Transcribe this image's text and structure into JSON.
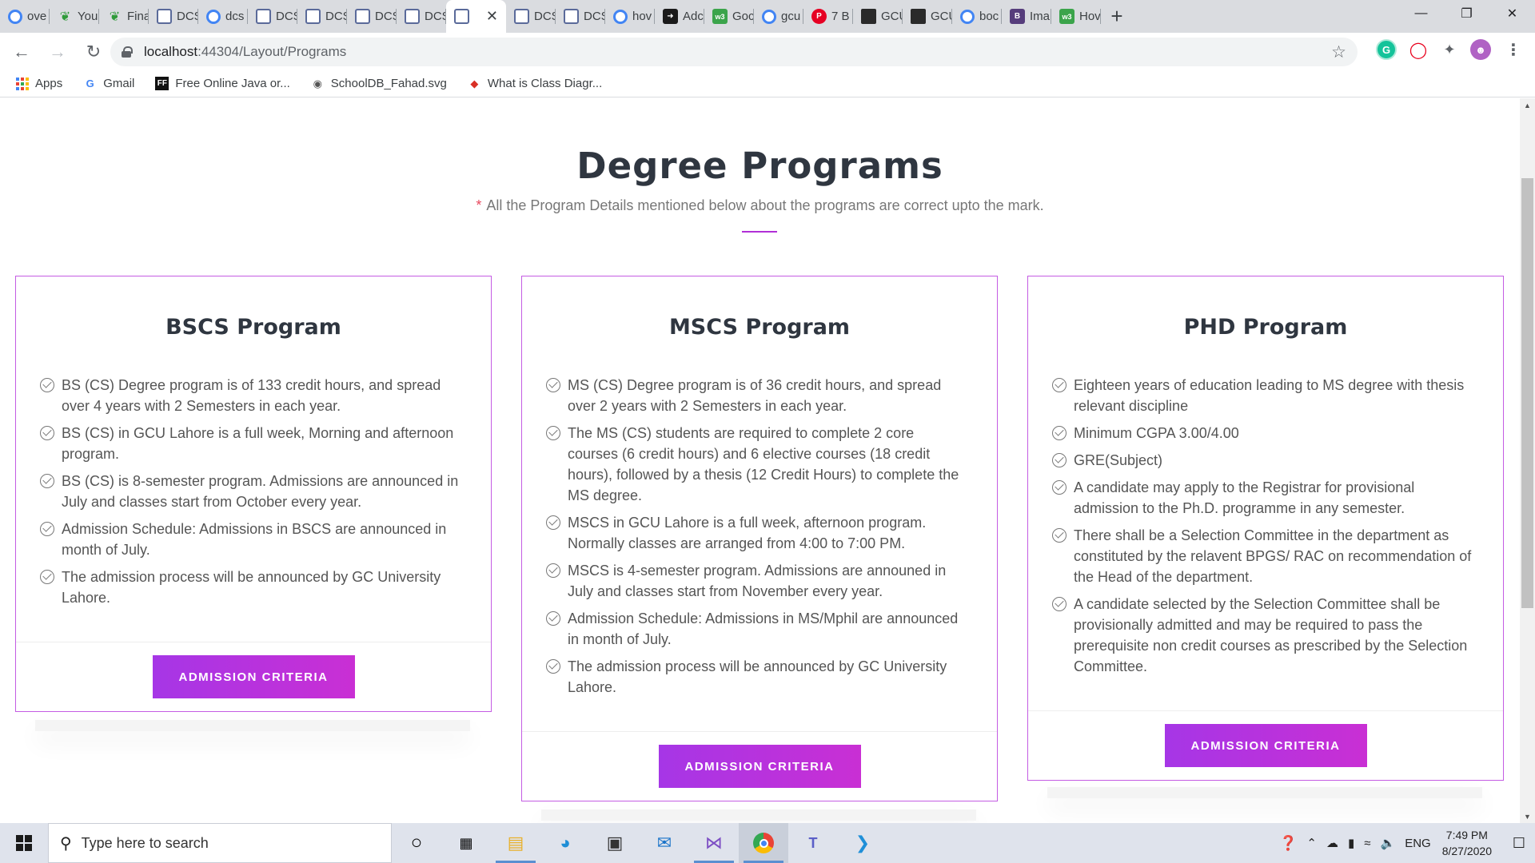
{
  "browser": {
    "tabs": [
      {
        "label": "ove",
        "icon": "google-icon"
      },
      {
        "label": "You",
        "icon": "leaf-icon"
      },
      {
        "label": "Fina",
        "icon": "leaf-icon"
      },
      {
        "label": "DCS",
        "icon": "shield-icon"
      },
      {
        "label": "dcs",
        "icon": "google-icon"
      },
      {
        "label": "DCS",
        "icon": "shield-icon"
      },
      {
        "label": "DCS",
        "icon": "shield-icon"
      },
      {
        "label": "DCS",
        "icon": "shield-icon"
      },
      {
        "label": "DCS",
        "icon": "shield-icon"
      },
      {
        "label": "",
        "icon": "shield-icon",
        "active": true
      },
      {
        "label": "DCS",
        "icon": "shield-icon"
      },
      {
        "label": "DCS",
        "icon": "shield-icon"
      },
      {
        "label": "hov",
        "icon": "google-icon"
      },
      {
        "label": "Adc",
        "icon": "arrow-icon"
      },
      {
        "label": "Goc",
        "icon": "w3-icon"
      },
      {
        "label": "gcu",
        "icon": "google-icon"
      },
      {
        "label": "7 B",
        "icon": "pinterest-icon"
      },
      {
        "label": "GCU",
        "icon": "crest-icon"
      },
      {
        "label": "GCU",
        "icon": "crest-icon"
      },
      {
        "label": "boc",
        "icon": "google-icon"
      },
      {
        "label": "Ima",
        "icon": "bootstrap-icon"
      },
      {
        "label": "Hov",
        "icon": "w3-icon"
      }
    ],
    "new_tab": "+",
    "url_host": "localhost",
    "url_path": ":44304/Layout/Programs",
    "bookmarks": [
      {
        "label": "Apps",
        "icon": "apps-icon"
      },
      {
        "label": "Gmail",
        "icon": "google-icon"
      },
      {
        "label": "Free Online Java or...",
        "icon": "ff-icon"
      },
      {
        "label": "SchoolDB_Fahad.svg",
        "icon": "globe-icon"
      },
      {
        "label": "What is Class Diagr...",
        "icon": "diamond-icon"
      }
    ]
  },
  "page": {
    "title": "Degree Programs",
    "subtitle_marker": "*",
    "subtitle": "All the Program Details mentioned below about the programs are correct upto the mark.",
    "accent_color": "#b12fd6",
    "programs": [
      {
        "title": "BSCS Program",
        "items": [
          "BS (CS) Degree program is of 133 credit hours, and spread over 4 years with 2 Semesters in each year.",
          "BS (CS) in GCU Lahore is a full week, Morning and afternoon program.",
          "BS (CS) is 8-semester program. Admissions are announced in July and classes start from October every year.",
          "Admission Schedule: Admissions in BSCS are announced in month of July.",
          "The admission process will be announced by GC University Lahore."
        ],
        "button": "ADMISSION CRITERIA"
      },
      {
        "title": "MSCS Program",
        "items": [
          "MS (CS) Degree program is of 36 credit hours, and spread over 2 years with 2 Semesters in each year.",
          "The MS (CS) students are required to complete 2 core courses (6 credit hours) and 6 elective courses (18 credit hours), followed by a thesis (12 Credit Hours) to complete the MS degree.",
          "MSCS in GCU Lahore is a full week, afternoon program. Normally classes are arranged from 4:00 to 7:00 PM.",
          "MSCS is 4-semester program. Admissions are announed in July and classes start from November every year.",
          "Admission Schedule: Admissions in MS/Mphil are announced in month of July.",
          "The admission process will be announced by GC University Lahore."
        ],
        "button": "ADMISSION CRITERIA"
      },
      {
        "title": "PHD Program",
        "items": [
          "Eighteen years of education leading to MS degree with thesis relevant discipline",
          "Minimum CGPA 3.00/4.00",
          "GRE(Subject)",
          "A candidate may apply to the Registrar for provisional admission to the Ph.D. programme in any semester.",
          "There shall be a Selection Committee in the department as constituted by the relavent BPGS/ RAC on recommendation of the Head of the department.",
          "A candidate selected by the Selection Committee shall be provisionally admitted and may be required to pass the prerequisite non credit courses as prescribed by the Selection Committee."
        ],
        "button": "ADMISSION CRITERIA"
      }
    ]
  },
  "taskbar": {
    "search_placeholder": "Type here to search",
    "language": "ENG",
    "time": "7:49 PM",
    "date": "8/27/2020"
  }
}
